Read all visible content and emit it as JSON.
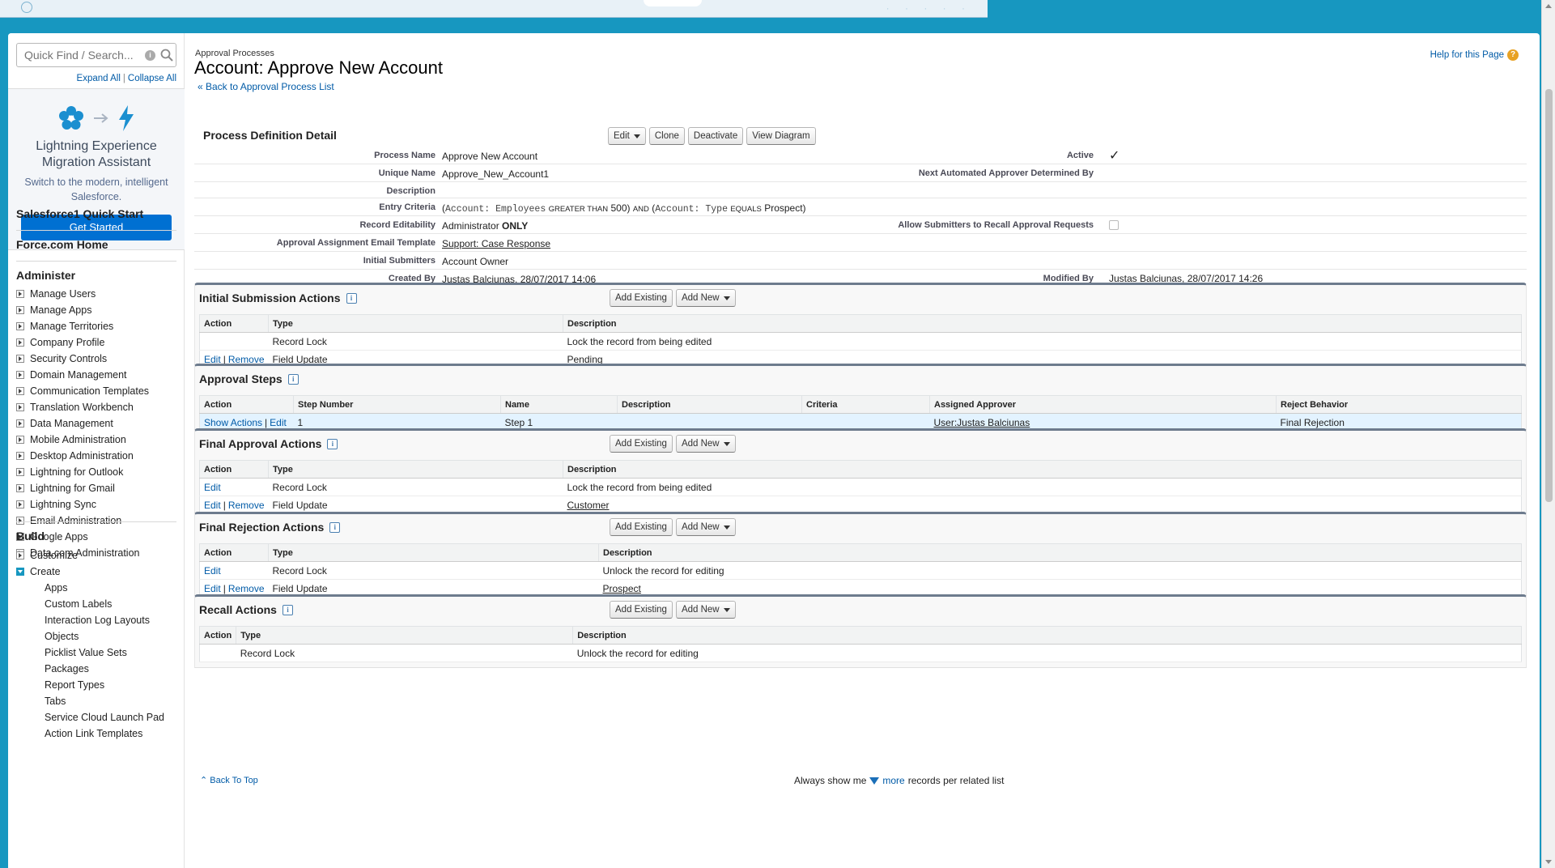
{
  "sidebar": {
    "search_placeholder": "Quick Find / Search...",
    "expand_all": "Expand All",
    "collapse_all": "Collapse All",
    "lex": {
      "title": "Lightning Experience Migration Assistant",
      "subtitle": "Switch to the modern, intelligent Salesforce.",
      "button": "Get Started"
    },
    "quick_start": "Salesforce1 Quick Start",
    "force_home": "Force.com Home",
    "administer_title": "Administer",
    "administer_items": [
      "Manage Users",
      "Manage Apps",
      "Manage Territories",
      "Company Profile",
      "Security Controls",
      "Domain Management",
      "Communication Templates",
      "Translation Workbench",
      "Data Management",
      "Mobile Administration",
      "Desktop Administration",
      "Lightning for Outlook",
      "Lightning for Gmail",
      "Lightning Sync",
      "Email Administration",
      "Google Apps",
      "Data.com Administration"
    ],
    "build_title": "Build",
    "build_items": [
      "Customize",
      "Create"
    ],
    "create_children": [
      "Apps",
      "Custom Labels",
      "Interaction Log Layouts",
      "Objects",
      "Picklist Value Sets",
      "Packages",
      "Report Types",
      "Tabs",
      "Service Cloud Launch Pad",
      "Action Link Templates"
    ]
  },
  "header": {
    "breadcrumb": "Approval Processes",
    "title": "Account: Approve New Account",
    "back_link": "« Back to Approval Process List",
    "help": "Help for this Page"
  },
  "detail": {
    "title": "Process Definition Detail",
    "buttons": {
      "edit": "Edit",
      "clone": "Clone",
      "deactivate": "Deactivate",
      "view_diagram": "View Diagram"
    },
    "process_name_label": "Process Name",
    "process_name": "Approve New Account",
    "active_label": "Active",
    "active_check": "✓",
    "unique_name_label": "Unique Name",
    "unique_name": "Approve_New_Account1",
    "next_approver_label": "Next Automated Approver Determined By",
    "description_label": "Description",
    "entry_criteria_label": "Entry Criteria",
    "entry_criteria": {
      "p1": "(",
      "field1": "Account: Employees",
      "op1": "GREATER THAN",
      "v1": "500)",
      "and": "AND",
      "p2": "(",
      "field2": "Account: Type",
      "op2": "EQUALS",
      "v2": "Prospect)"
    },
    "record_edit_label": "Record Editability",
    "record_edit_prefix": "Administrator",
    "record_edit_strong": "ONLY",
    "allow_recall_label": "Allow Submitters to Recall Approval Requests",
    "email_template_label": "Approval Assignment Email Template",
    "email_template": "Support: Case Response",
    "initial_submitters_label": "Initial Submitters",
    "initial_submitters": "Account Owner",
    "created_by_label": "Created By",
    "created_by_name": "Justas Balciunas",
    "created_by_date": ", 28/07/2017 14:06",
    "modified_by_label": "Modified By",
    "modified_by_name": "Justas Balciunas",
    "modified_by_date": ", 28/07/2017 14:26"
  },
  "common": {
    "add_existing": "Add Existing",
    "add_new": "Add New",
    "edit": "Edit",
    "remove": "Remove",
    "pipe": "|",
    "info": "i",
    "col_action": "Action",
    "col_type": "Type",
    "col_description": "Description"
  },
  "initial_submission": {
    "title": "Initial Submission Actions",
    "rows": [
      {
        "type": "Record Lock",
        "description": "Lock the record from being edited"
      },
      {
        "type": "Field Update",
        "description": "Pending"
      }
    ]
  },
  "approval_steps": {
    "title": "Approval Steps",
    "columns": [
      "Action",
      "Step Number",
      "Name",
      "Description",
      "Criteria",
      "Assigned Approver",
      "Reject Behavior"
    ],
    "row": {
      "show_actions": "Show Actions",
      "edit": "Edit",
      "step": "1",
      "name": "Step 1",
      "approver": "User:Justas Balciunas",
      "reject": "Final Rejection"
    }
  },
  "final_approval": {
    "title": "Final Approval Actions",
    "rows": [
      {
        "type": "Record Lock",
        "description": "Lock the record from being edited"
      },
      {
        "type": "Field Update",
        "description": "Customer"
      }
    ]
  },
  "final_rejection": {
    "title": "Final Rejection Actions",
    "rows": [
      {
        "type": "Record Lock",
        "description": "Unlock the record for editing"
      },
      {
        "type": "Field Update",
        "description": "Prospect"
      }
    ]
  },
  "recall": {
    "title": "Recall Actions",
    "rows": [
      {
        "type": "Record Lock",
        "description": "Unlock the record for editing"
      }
    ]
  },
  "footer": {
    "back_to_top": "Back To Top",
    "always_show": "Always show me",
    "more": "more",
    "per_list": "records per related list"
  }
}
